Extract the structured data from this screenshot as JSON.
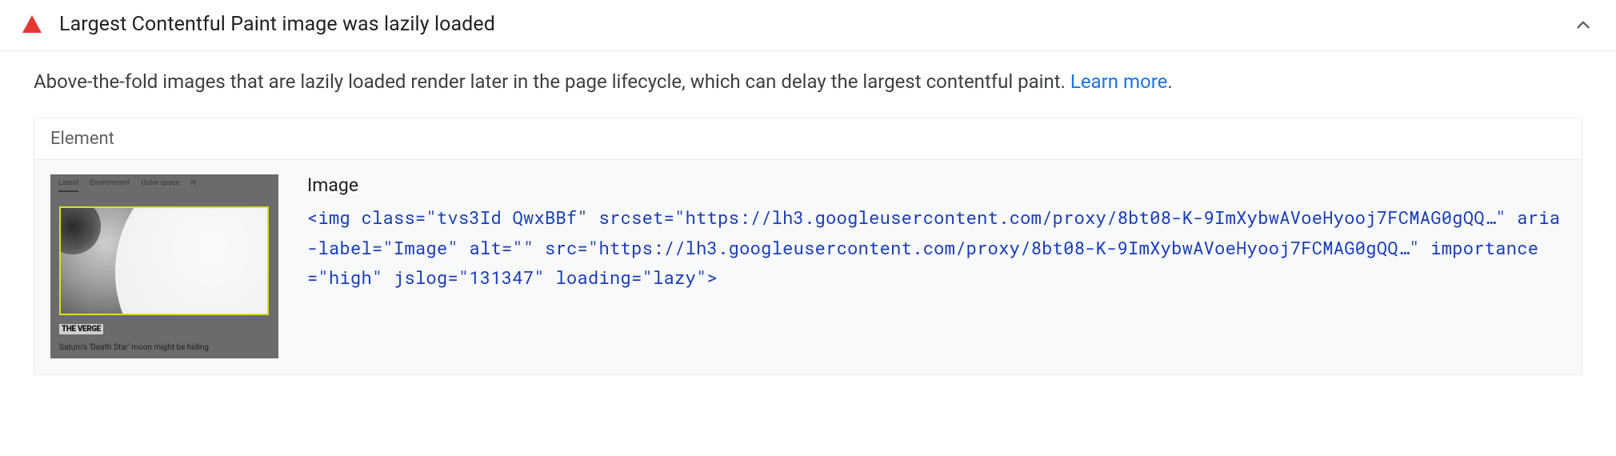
{
  "audit": {
    "title": "Largest Contentful Paint image was lazily loaded",
    "description_prefix": "Above-the-fold images that are lazily loaded render later in the page lifecycle, which can delay the largest contentful paint. ",
    "learn_more": "Learn more",
    "description_suffix": ".",
    "status": "fail"
  },
  "panel": {
    "column_header": "Element",
    "item": {
      "label": "Image",
      "code": "<img class=\"tvs3Id QwxBBf\" srcset=\"https://lh3.googleusercontent.com/proxy/8bt08-K-9ImXybwAVoeHyooj7FCMAG0gQQ…\" aria-label=\"Image\" alt=\"\" src=\"https://lh3.googleusercontent.com/proxy/8bt08-K-9ImXybwAVoeHyooj7FCMAG0gQQ…\" importance=\"high\" jslog=\"131347\" loading=\"lazy\">"
    }
  },
  "thumbnail": {
    "tabs": [
      "Latest",
      "Environment",
      "Outer space",
      "N"
    ],
    "source": "THE VERGE",
    "caption": "Saturn's 'Death Star' moon might be hiding"
  }
}
